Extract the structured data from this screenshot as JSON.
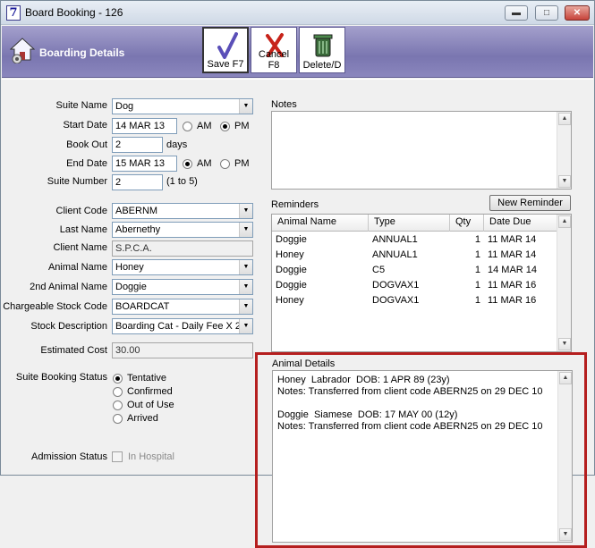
{
  "window": {
    "title": "Board Booking - 126",
    "app_icon_glyph": "7",
    "controls": {
      "minimize": "▬",
      "maximize": "□",
      "close": "✕"
    }
  },
  "header": {
    "title": "Boarding Details",
    "buttons": {
      "save": "Save F7",
      "cancel": "Cancel F8",
      "delete": "Delete/D"
    }
  },
  "form": {
    "suite_name": {
      "label": "Suite Name",
      "value": "Dog"
    },
    "start_date": {
      "label": "Start Date",
      "value": "14 MAR 13",
      "am": "AM",
      "pm": "PM",
      "selected": "PM"
    },
    "book_out": {
      "label": "Book Out",
      "value": "2",
      "unit": "days"
    },
    "end_date": {
      "label": "End Date",
      "value": "15 MAR 13",
      "am": "AM",
      "pm": "PM",
      "selected": "AM"
    },
    "suite_number": {
      "label": "Suite Number",
      "value": "2",
      "hint": "(1 to 5)"
    },
    "client_code": {
      "label": "Client Code",
      "value": "ABERNM"
    },
    "last_name": {
      "label": "Last Name",
      "value": "Abernethy"
    },
    "client_name": {
      "label": "Client Name",
      "value": "S.P.C.A."
    },
    "animal_name": {
      "label": "Animal Name",
      "value": "Honey"
    },
    "second_animal": {
      "label": "2nd Animal Name",
      "value": "Doggie"
    },
    "stock_code": {
      "label": "Chargeable Stock Code",
      "value": "BOARDCAT"
    },
    "stock_desc": {
      "label": "Stock Description",
      "value": "Boarding Cat - Daily Fee X 2"
    },
    "estimated_cost": {
      "label": "Estimated Cost",
      "value": "30.00"
    },
    "booking_status": {
      "label": "Suite Booking Status",
      "options": [
        "Tentative",
        "Confirmed",
        "Out of Use",
        "Arrived"
      ],
      "selected": "Tentative"
    },
    "admission": {
      "label": "Admission Status",
      "checkbox_label": "In Hospital",
      "checked": false
    }
  },
  "notes": {
    "label": "Notes",
    "value": ""
  },
  "reminders": {
    "label": "Reminders",
    "new_button": "New Reminder",
    "columns": [
      "Animal Name",
      "Type",
      "Qty",
      "Date Due"
    ],
    "rows": [
      [
        "Doggie",
        "ANNUAL1",
        "1",
        "11 MAR 14"
      ],
      [
        "Honey",
        "ANNUAL1",
        "1",
        "11 MAR 14"
      ],
      [
        "Doggie",
        "C5",
        "1",
        "14 MAR 14"
      ],
      [
        "Doggie",
        "DOGVAX1",
        "1",
        "11 MAR 16"
      ],
      [
        "Honey",
        "DOGVAX1",
        "1",
        "11 MAR 16"
      ]
    ]
  },
  "animal_details": {
    "label": "Animal Details",
    "text": "Honey  Labrador  DOB: 1 APR 89 (23y)\nNotes: Transferred from client code ABERN25 on 29 DEC 10\n\nDoggie  Siamese  DOB: 17 MAY 00 (12y)\nNotes: Transferred from client code ABERN25 on 29 DEC 10"
  },
  "colors": {
    "header_bg": "#8a86bd",
    "highlight": "#b51f1f"
  }
}
